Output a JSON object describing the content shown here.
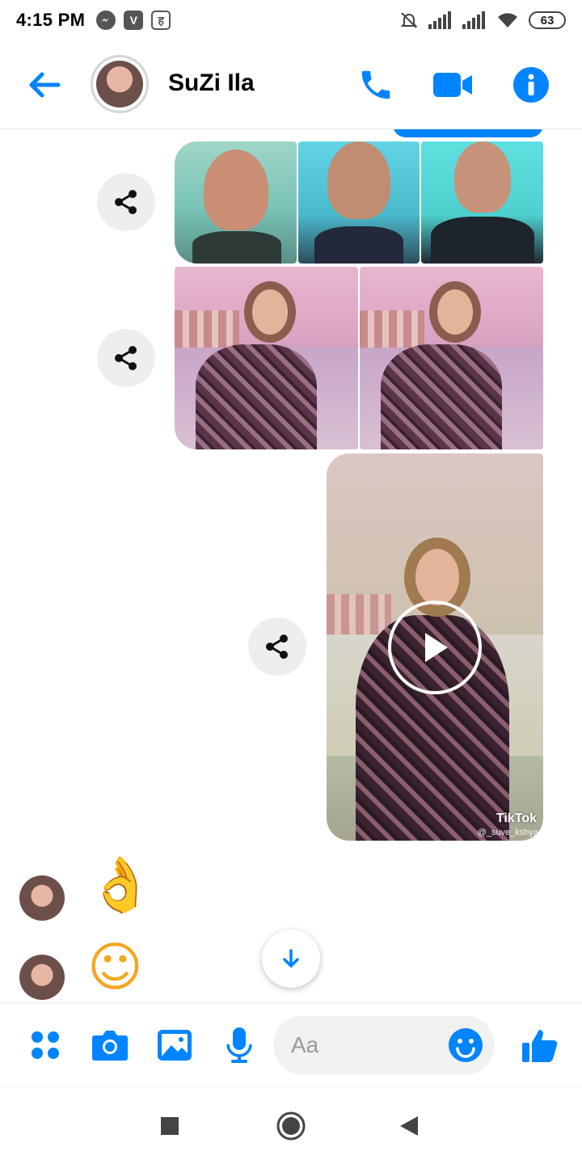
{
  "status_bar": {
    "time": "4:15 PM",
    "icons": [
      "messenger-icon",
      "v-app-icon",
      "keyboard-app-icon"
    ],
    "v_label": "V",
    "k_label": "ह",
    "battery": "63"
  },
  "header": {
    "title": "SuZi Ila",
    "actions": [
      "phone-icon",
      "video-camera-icon",
      "info-icon"
    ]
  },
  "messages": {
    "photo_row_1_count": 3,
    "photo_row_2_count": 2,
    "video": {
      "watermark": "TikTok",
      "username": "@_suve_kshya"
    },
    "reactions": [
      "👌",
      "☺"
    ]
  },
  "composer": {
    "placeholder": "Aa"
  },
  "colors": {
    "accent": "#0084ff",
    "share_bg": "#eeeeee"
  }
}
